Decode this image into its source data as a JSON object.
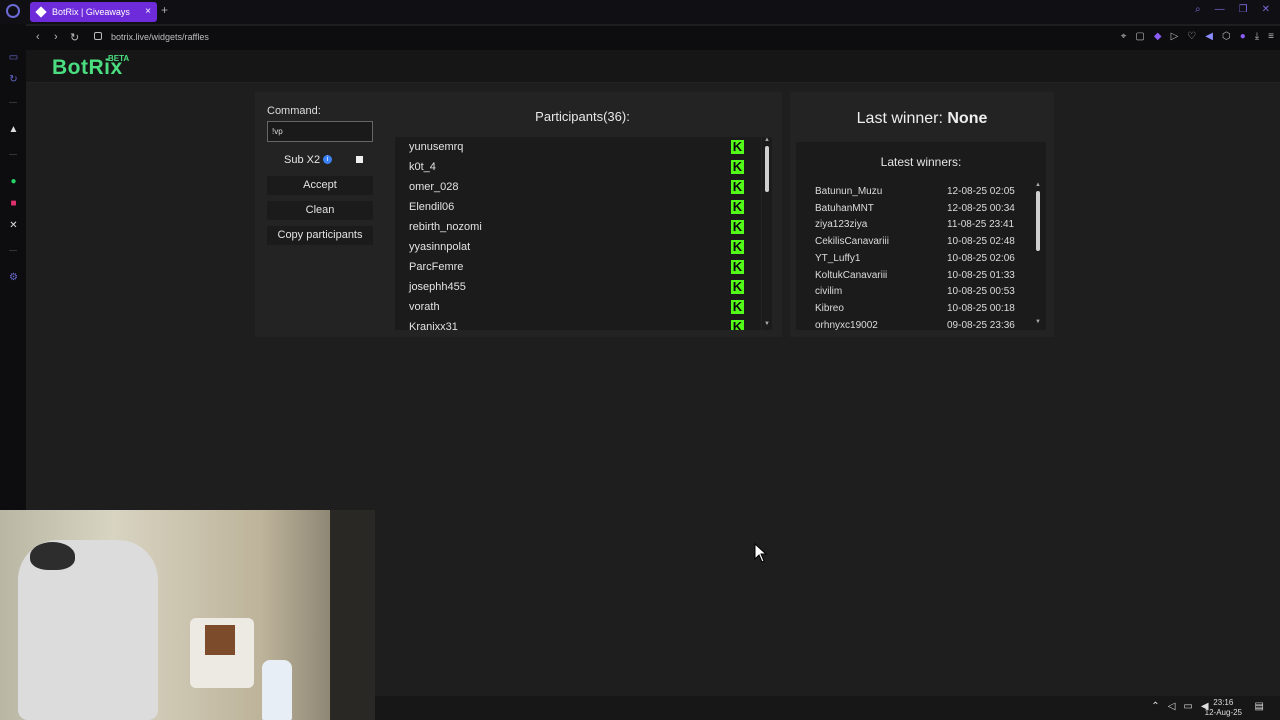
{
  "browser": {
    "tab_title": "BotRix | Giveaways",
    "tab_close": "×",
    "new_tab": "+",
    "url": "botrix.live/widgets/raffles",
    "nav_back": "‹",
    "nav_forward": "›",
    "nav_reload": "↻"
  },
  "header": {
    "logo": "BotRix",
    "beta": "BETA"
  },
  "raffle": {
    "command_label": "Command:",
    "command_value": "!vp",
    "subx2_label": "Sub X2",
    "info": "i",
    "accept": "Accept",
    "clean": "Clean",
    "copy": "Copy participants",
    "participants_title": "Participants(36):",
    "kick_icon": "K",
    "participants": [
      "yunusemrq",
      "k0t_4",
      "omer_028",
      "Elendil06",
      "rebirth_nozomi",
      "yyasinnpolat",
      "ParcFemre",
      "josephh455",
      "vorath",
      "Kranixx31"
    ]
  },
  "winners": {
    "last_label": "Last winner:",
    "last_value": "None",
    "latest_title": "Latest winners:",
    "list": [
      {
        "name": "Batunun_Muzu",
        "date": "12-08-25 02:05"
      },
      {
        "name": "BatuhanMNT",
        "date": "12-08-25 00:34"
      },
      {
        "name": "ziya123ziya",
        "date": "11-08-25 23:41"
      },
      {
        "name": "CekilisCanavariii",
        "date": "10-08-25 02:48"
      },
      {
        "name": "YT_Luffy1",
        "date": "10-08-25 02:06"
      },
      {
        "name": "KoltukCanavariii",
        "date": "10-08-25 01:33"
      },
      {
        "name": "civilim",
        "date": "10-08-25 00:53"
      },
      {
        "name": "Kibreo",
        "date": "10-08-25 00:18"
      },
      {
        "name": "orhnyxc19002",
        "date": "09-08-25 23:36"
      }
    ]
  },
  "taskbar": {
    "time": "23:16",
    "date": "12-Aug-25"
  }
}
